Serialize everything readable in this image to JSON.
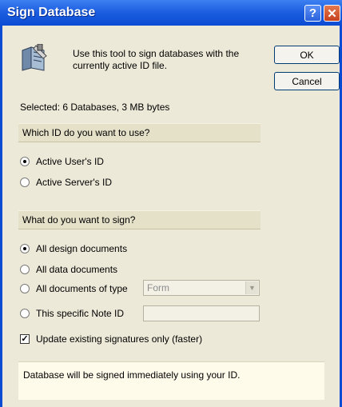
{
  "window": {
    "title": "Sign Database",
    "help_label": "?",
    "close_label": "✕"
  },
  "description": "Use this tool to sign databases with the currently active ID file.",
  "buttons": {
    "ok": "OK",
    "cancel": "Cancel"
  },
  "selected_text": "Selected:  6 Databases, 3 MB bytes",
  "id_section": {
    "header": "Which ID do you want to use?",
    "options": [
      {
        "label": "Active User's ID",
        "checked": true
      },
      {
        "label": "Active Server's ID",
        "checked": false
      }
    ]
  },
  "sign_section": {
    "header": "What do you want to sign?",
    "options": [
      {
        "label": "All design documents",
        "checked": true
      },
      {
        "label": "All data documents",
        "checked": false
      },
      {
        "label": "All documents of type",
        "checked": false
      },
      {
        "label": "This specific Note ID",
        "checked": false
      }
    ],
    "doc_type_value": "Form",
    "note_id_value": ""
  },
  "update_checkbox": {
    "label": "Update existing signatures only (faster)",
    "checked": true
  },
  "info_text": "Database will be signed immediately using your ID.",
  "colors": {
    "titlebar": "#0a4bd3",
    "dialog_bg": "#ece9d8",
    "section_bg": "#e5e1c9",
    "info_bg": "#fffbea"
  }
}
